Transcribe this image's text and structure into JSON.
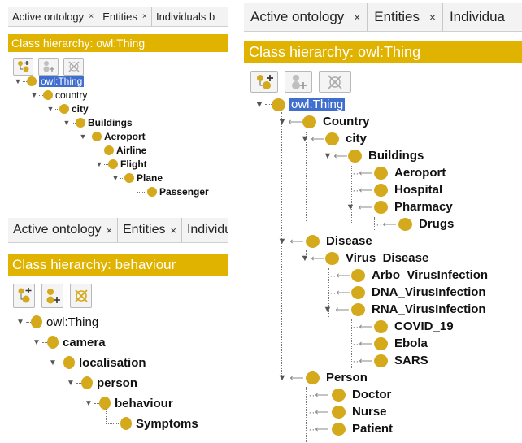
{
  "panel_a": {
    "tabs": [
      {
        "label": "Active ontology",
        "close": "×"
      },
      {
        "label": "Entities",
        "close": "×"
      },
      {
        "label": "Individuals b",
        "close": ""
      }
    ],
    "header": "Class hierarchy: owl:Thing",
    "nodes": [
      {
        "label": "owl:Thing",
        "selected": true
      },
      {
        "label": "country"
      },
      {
        "label": "city"
      },
      {
        "label": "Buildings"
      },
      {
        "label": "Aeroport"
      },
      {
        "label": "Airline"
      },
      {
        "label": "Flight"
      },
      {
        "label": "Plane"
      },
      {
        "label": "Passenger"
      }
    ]
  },
  "panel_b": {
    "tabs": [
      {
        "label": "Active ontology",
        "close": "×"
      },
      {
        "label": "Entities",
        "close": "×"
      },
      {
        "label": "Individuals",
        "close": ""
      }
    ],
    "header": "Class hierarchy: behaviour",
    "nodes": [
      {
        "label": "owl:Thing"
      },
      {
        "label": "camera"
      },
      {
        "label": "localisation"
      },
      {
        "label": "person"
      },
      {
        "label": "behaviour"
      },
      {
        "label": "Symptoms"
      }
    ]
  },
  "panel_c": {
    "tabs": [
      {
        "label": "Active ontology",
        "close": "×"
      },
      {
        "label": "Entities",
        "close": "×"
      },
      {
        "label": "Individua",
        "close": ""
      }
    ],
    "header": "Class hierarchy: owl:Thing",
    "nodes": [
      {
        "label": "owl:Thing",
        "selected": true
      },
      {
        "label": "Country"
      },
      {
        "label": "city"
      },
      {
        "label": "Buildings"
      },
      {
        "label": "Aeroport"
      },
      {
        "label": "Hospital"
      },
      {
        "label": "Pharmacy"
      },
      {
        "label": "Drugs"
      },
      {
        "label": "Disease"
      },
      {
        "label": "Virus_Disease"
      },
      {
        "label": "Arbo_VirusInfection"
      },
      {
        "label": "DNA_VirusInfection"
      },
      {
        "label": "RNA_VirusInfection"
      },
      {
        "label": "COVID_19"
      },
      {
        "label": "Ebola"
      },
      {
        "label": "SARS"
      },
      {
        "label": "Person"
      },
      {
        "label": "Doctor"
      },
      {
        "label": "Nurse"
      },
      {
        "label": "Patient"
      }
    ]
  },
  "colors": {
    "header": "#e0b300",
    "node": "#d4a91c",
    "selection": "#3f6ecf"
  },
  "icons": [
    "add-subclass-icon",
    "add-sibling-icon",
    "delete-class-icon",
    "expand-arrow-icon",
    "class-node-icon"
  ]
}
